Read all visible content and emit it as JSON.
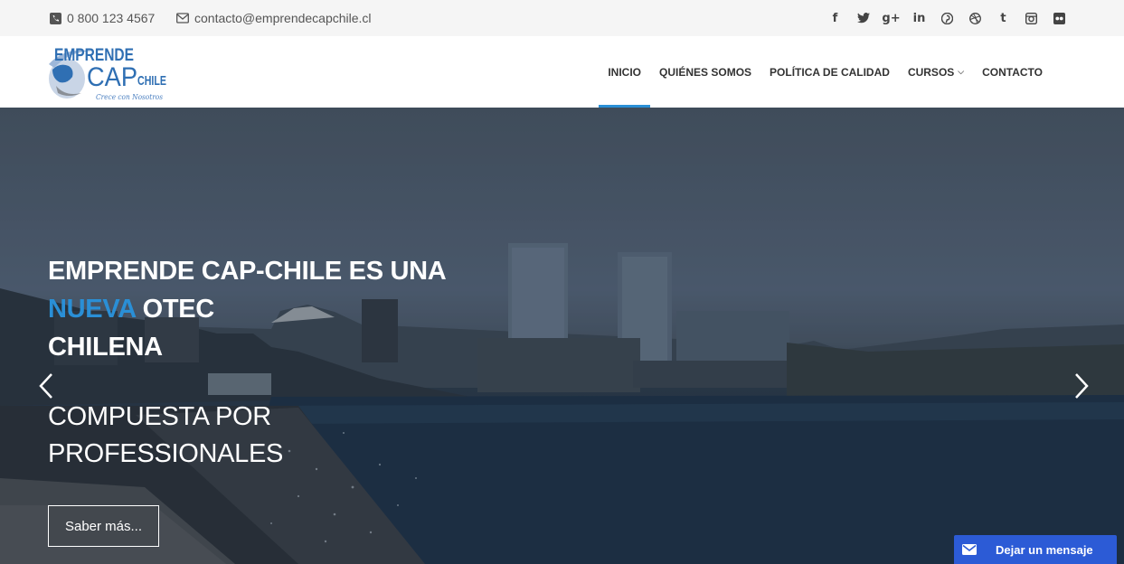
{
  "topbar": {
    "phone": "0 800 123 4567",
    "email": "contacto@emprendecapchile.cl",
    "socials": [
      "facebook-icon",
      "twitter-icon",
      "google-plus-icon",
      "linkedin-icon",
      "pinterest-icon",
      "dribbble-icon",
      "tumblr-icon",
      "instagram-icon",
      "flickr-icon"
    ]
  },
  "logo": {
    "line1": "EMPRENDE",
    "line2a": "CAP",
    "line2b": "CHILE",
    "tagline": "Crece con Nosotros"
  },
  "nav": {
    "items": [
      "INICIO",
      "QUIÉNES SOMOS",
      "POLÍTICA DE CALIDAD",
      "CURSOS",
      "CONTACTO"
    ],
    "active": "INICIO",
    "accent_color": "#2a8fd6"
  },
  "hero": {
    "title_part1": "EMPRENDE CAP-CHILE ES UNA",
    "title_highlight": "NUEVA",
    "title_part2": "OTEC",
    "title_part3": "CHILENA",
    "subtitle_line1": "COMPUESTA POR",
    "subtitle_line2": "PROFESSIONALES",
    "button_label": "Saber más..."
  },
  "chat": {
    "label": "Dejar un mensaje",
    "color": "#2c5bd6"
  }
}
